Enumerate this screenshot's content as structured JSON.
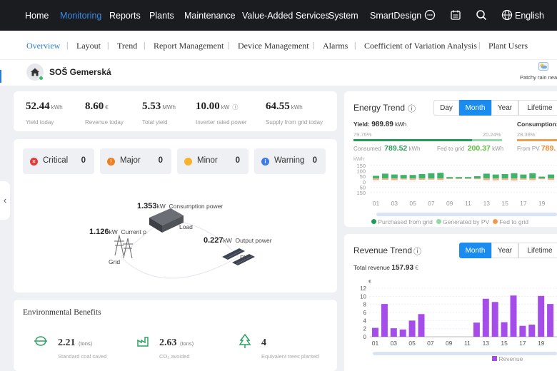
{
  "nav": {
    "items": [
      "Home",
      "Monitoring",
      "Reports",
      "Plants",
      "Maintenance",
      "Value-Added Services",
      "System",
      "SmartDesign"
    ],
    "active": "Monitoring",
    "language": "English",
    "icons": [
      "chat-icon",
      "calendar-icon",
      "search-icon",
      "globe-icon"
    ]
  },
  "subnav": {
    "items": [
      "Overview",
      "Layout",
      "Trend",
      "Report Management",
      "Device Management",
      "Alarms",
      "Coefficient of Variation Analysis",
      "Plant Users"
    ],
    "active": "Overview"
  },
  "plant": {
    "name": "SOŠ Gemerská",
    "weather": "Patchy rain nea",
    "status_color": "#2dbf6b"
  },
  "kpis": [
    {
      "value": "52.44",
      "unit": "kWh",
      "label": "Yield today"
    },
    {
      "value": "8.60",
      "unit": "€",
      "label": "Revenue today"
    },
    {
      "value": "5.53",
      "unit": "MWh",
      "label": "Total yield"
    },
    {
      "value": "10.00",
      "unit": "kW",
      "label": "Inverter rated power"
    },
    {
      "value": "64.55",
      "unit": "kWh",
      "label": "Supply from grid today"
    }
  ],
  "alarms": [
    {
      "label": "Critical",
      "count": "0",
      "color": "#e23a3a",
      "icon": "×"
    },
    {
      "label": "Major",
      "count": "0",
      "color": "#f27d1c",
      "icon": "!"
    },
    {
      "label": "Minor",
      "count": "0",
      "color": "#f7b32b",
      "icon": ""
    },
    {
      "label": "Warning",
      "count": "0",
      "color": "#3b7be8",
      "icon": "i"
    }
  ],
  "flow": {
    "consumption_value": "1.353",
    "consumption_unit": "kW",
    "consumption_label": "Consumption power",
    "current_value": "1.126",
    "current_unit": "kW",
    "current_label": "Current p",
    "output_value": "0.227",
    "output_unit": "kW",
    "output_label": "Output power",
    "load_label": "Load",
    "grid_label": "Grid",
    "pv_label": "PV"
  },
  "env": {
    "title": "Environmental Benefits",
    "items": [
      {
        "value": "2.21",
        "unit": "(tons)",
        "label": "Standard coal saved"
      },
      {
        "value": "2.63",
        "unit": "(tons)",
        "label": "CO₂ avoided"
      },
      {
        "value": "4",
        "unit": "",
        "label": "Equivalent trees planted"
      }
    ]
  },
  "energy": {
    "title": "Energy Trend",
    "tabs": [
      "Day",
      "Month",
      "Year",
      "Lifetime"
    ],
    "active_tab": "Month",
    "yield_label": "Yield:",
    "yield_value": "989.89",
    "yield_unit": "kWh",
    "consumption_label": "Consumption:",
    "pct_left": "79.76%",
    "pct_right": "20.24%",
    "pct_cons": "28.38%",
    "consumed_label": "Consumed",
    "consumed_value": "789.52",
    "consumed_unit": "kWh",
    "fed_label": "Fed to grid",
    "fed_value": "200.37",
    "fed_unit": "kWh",
    "frompv_label": "From PV",
    "frompv_value": "789.",
    "self_fraction": 0.7976,
    "legend": [
      "Purchased from grid",
      "Generated by PV",
      "Fed to grid"
    ],
    "colors": {
      "purchased": "#1f9d55",
      "generated": "#8fd9a4",
      "fed": "#f39a4f",
      "bar_green": "#3fb36b",
      "bar_orange": "#f6b48a"
    }
  },
  "revenue": {
    "title": "Revenue Trend",
    "tabs": [
      "Month",
      "Year",
      "Lifetime"
    ],
    "active_tab": "Month",
    "total_label": "Total revenue",
    "total_value": "157.93",
    "total_unit": "€",
    "legend": "Revenue",
    "color": "#a54de8"
  },
  "chart_data": [
    {
      "type": "bar",
      "title": "Energy Trend",
      "ylabel": "kWh",
      "ylim": [
        -150,
        150
      ],
      "yticks": [
        "150",
        "100",
        "50",
        "0",
        "50",
        "150"
      ],
      "categories": [
        "01",
        "02",
        "03",
        "04",
        "05",
        "06",
        "07",
        "08",
        "09",
        "10",
        "11",
        "12",
        "13",
        "14",
        "15",
        "16",
        "17",
        "18",
        "19",
        "20"
      ],
      "xtick_labels": [
        "01",
        "03",
        "05",
        "07",
        "09",
        "11",
        "13",
        "15",
        "17",
        "19"
      ],
      "series": [
        {
          "name": "Generated by PV",
          "values": [
            30,
            55,
            45,
            40,
            40,
            50,
            60,
            65,
            15,
            15,
            15,
            25,
            55,
            45,
            50,
            60,
            45,
            60,
            20,
            45
          ]
        },
        {
          "name": "Purchased from grid",
          "values": [
            -60,
            -50,
            -60,
            -40,
            -55,
            -50,
            -45,
            -55,
            -25,
            -25,
            -20,
            -30,
            -60,
            -65,
            -55,
            -70,
            -45,
            -60,
            -30,
            -55
          ]
        }
      ]
    },
    {
      "type": "bar",
      "title": "Revenue Trend",
      "ylabel": "€",
      "ylim": [
        0,
        12
      ],
      "yticks": [
        "12",
        "10",
        "8",
        "6",
        "4",
        "2",
        "0"
      ],
      "categories": [
        "01",
        "02",
        "03",
        "04",
        "05",
        "06",
        "07",
        "08",
        "09",
        "10",
        "11",
        "12",
        "13",
        "14",
        "15",
        "16",
        "17",
        "18",
        "19",
        "20"
      ],
      "xtick_labels": [
        "01",
        "03",
        "05",
        "07",
        "09",
        "11",
        "13",
        "15",
        "17",
        "19"
      ],
      "series": [
        {
          "name": "Revenue",
          "values": [
            2.2,
            8.1,
            2.1,
            1.8,
            4.0,
            5.6,
            0,
            0,
            0,
            0,
            0,
            3.5,
            9.4,
            8.6,
            3.6,
            10.2,
            2.7,
            3.0,
            10.1,
            8.1
          ]
        }
      ]
    }
  ]
}
